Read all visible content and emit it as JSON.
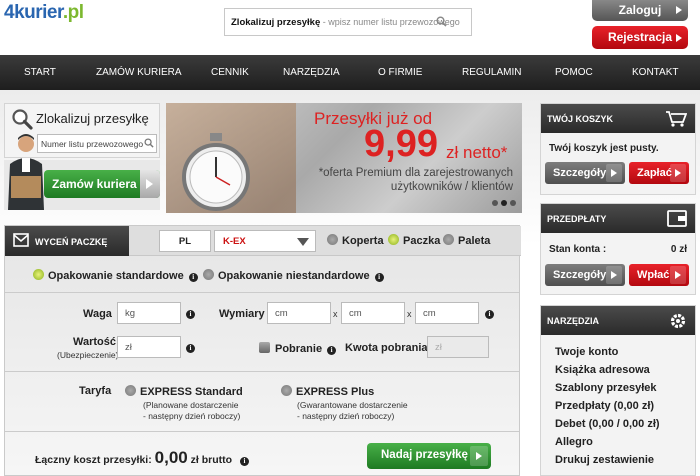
{
  "header": {
    "logo": {
      "prefix": "4kurier",
      "tld": ".pl"
    },
    "search": {
      "bold": "Zlokalizuj przesyłkę",
      "placeholder": "- wpisz numer listu przewozowego"
    },
    "login": "Zaloguj",
    "register": "Rejestracja"
  },
  "nav": [
    "START",
    "ZAMÓW KURIERA",
    "CENNIK",
    "NARZĘDZIA",
    "O FIRMIE",
    "REGULAMIN",
    "POMOC",
    "KONTAKT"
  ],
  "track": {
    "title": "Zlokalizuj przesyłkę",
    "placeholder": "Numer listu przewozowego",
    "order_button": "Zamów kuriera"
  },
  "banner": {
    "line1": "Przesyłki już od",
    "price": "9,99",
    "suffix": "zł netto*",
    "note1": "*oferta Premium dla zarejestrowanych",
    "note2": "użytkowników / klientów"
  },
  "cart": {
    "title": "TWÓJ KOSZYK",
    "empty": "Twój koszyk jest pusty.",
    "details": "Szczegóły",
    "pay": "Zapłać"
  },
  "prepaid": {
    "title": "PRZEDPŁATY",
    "balance_label": "Stan konta :",
    "balance_value": "0 zł",
    "details": "Szczegóły",
    "deposit": "Wpłać"
  },
  "tools": {
    "title": "NARZĘDZIA",
    "items": [
      "Twoje konto",
      "Książka adresowa",
      "Szablony przesyłek",
      "Przedpłaty (0,00 zł)",
      "Debet (0,00 / 0,00 zł)",
      "Allegro",
      "Drukuj zestawienie"
    ]
  },
  "form": {
    "tab": "WYCEŃ PACZKĘ",
    "country": "PL",
    "carrier": "K-EX",
    "types": [
      "Koperta",
      "Paczka",
      "Paleta"
    ],
    "pack_std": "Opakowanie standardowe",
    "pack_nonstd": "Opakowanie niestandardowe",
    "weight_label": "Waga",
    "weight_ph": "kg",
    "dims_label": "Wymiary",
    "dim_ph": "cm",
    "x": "x",
    "value_label": "Wartość",
    "value_sub": "(Ubezpieczenie)",
    "value_ph": "zł",
    "cod_label": "Pobranie",
    "cod_amount_label": "Kwota pobrania",
    "cod_ph": "zł",
    "tariff_label": "Taryfa",
    "t1": "EXPRESS Standard",
    "t1_n1": "(Planowane dostarczenie",
    "t1_n2": "- następny dzień roboczy)",
    "t2": "EXPRESS Plus",
    "t2_n1": "(Gwarantowane dostarczenie",
    "t2_n2": "- następny dzień roboczy)",
    "total_label": "Łączny koszt przesyłki:",
    "total_value": "0,00",
    "total_suffix": "zł brutto",
    "send": "Nadaj przesyłkę"
  }
}
